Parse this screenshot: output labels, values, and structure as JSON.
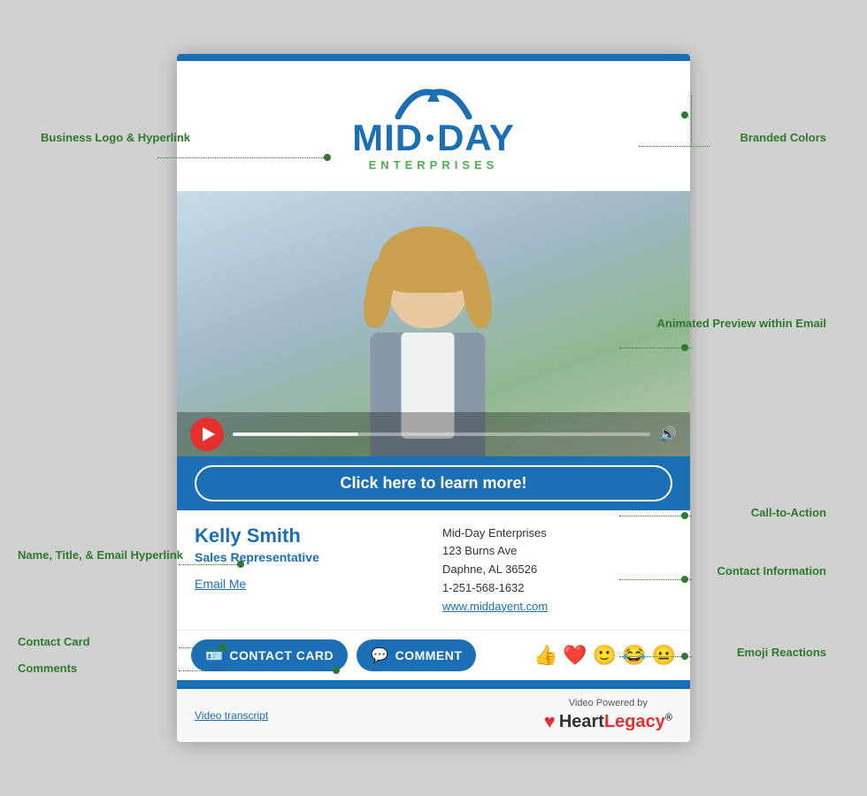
{
  "annotations": {
    "business_logo": "Business\nLogo &\nHyperlink",
    "branded_colors": "Branded\nColors",
    "animated_preview": "Animated\nPreview\nwithin Email",
    "cta": "Call-to-Action",
    "name_title": "Name, Title, &\nEmail Hyperlink",
    "contact_info": "Contact\nInformation",
    "contact_card": "Contact Card",
    "comments": "Comments",
    "emoji_reactions": "Emoji Reactions"
  },
  "logo": {
    "text_midday": "MID",
    "text_day": "DAY",
    "enterprises": "ENTERPRISES"
  },
  "cta": {
    "label": "Click here to learn more!"
  },
  "contact": {
    "name": "Kelly Smith",
    "title": "Sales Representative",
    "email_label": "Email Me",
    "company": "Mid-Day Enterprises",
    "address1": "123 Burns Ave",
    "address2": "Daphne, AL 36526",
    "phone": "1-251-568-1632",
    "website": "www.middayent.com"
  },
  "actions": {
    "contact_card_label": "CONTACT CARD",
    "comment_label": "COMMENT"
  },
  "emojis": [
    "👍",
    "❤️",
    "🙂",
    "😂",
    "😐"
  ],
  "footer": {
    "transcript_label": "Video transcript",
    "powered_by": "Video Powered by",
    "brand": "HeartLegacy"
  }
}
